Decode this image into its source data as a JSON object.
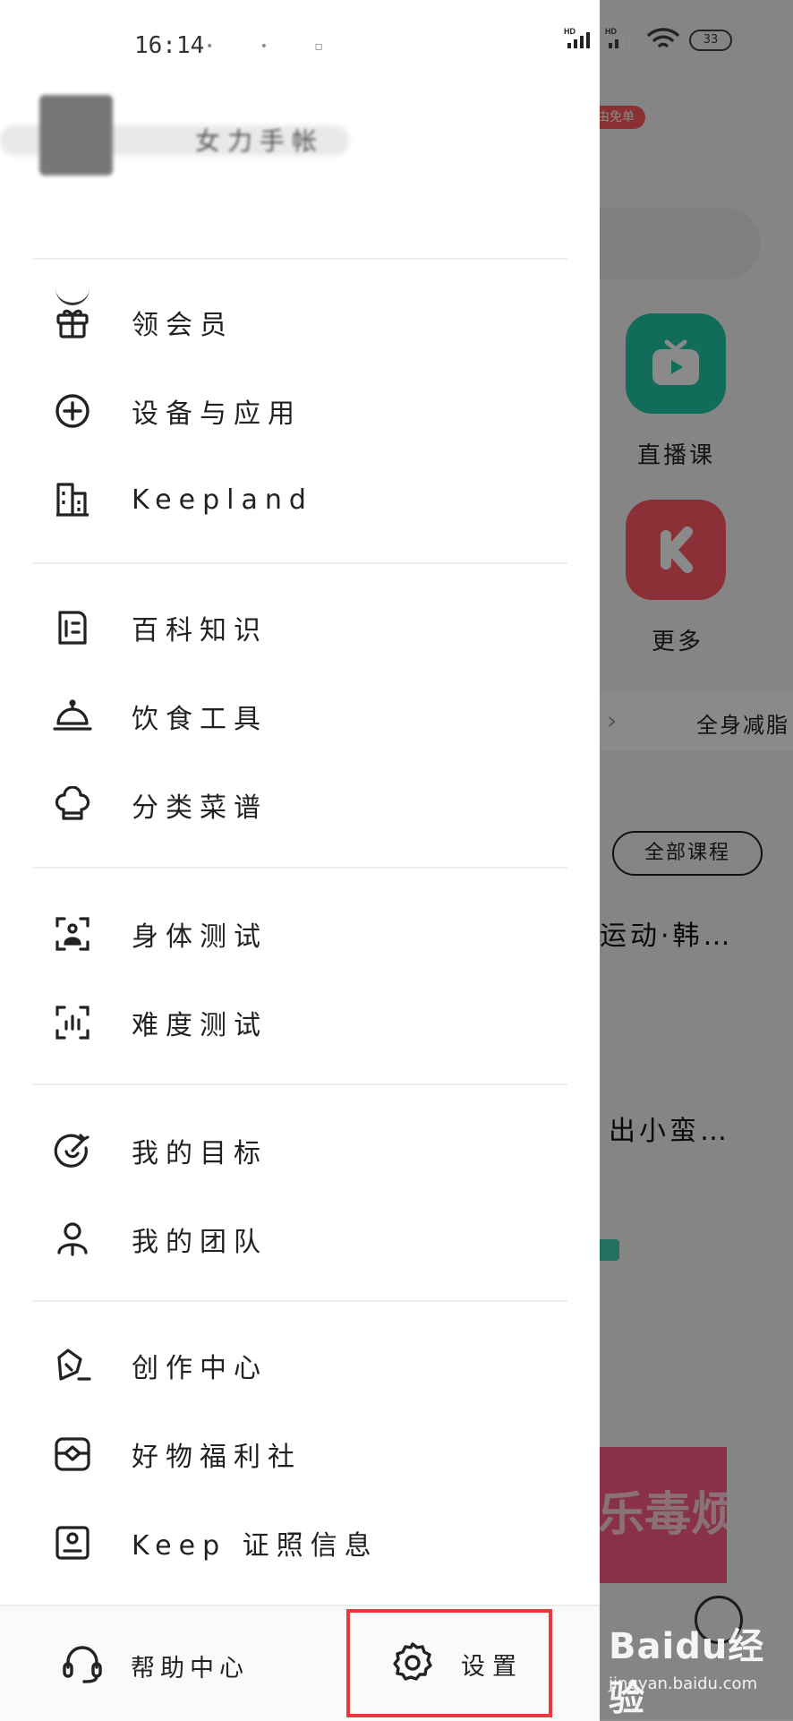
{
  "status_bar": {
    "time": "16:14",
    "hd1": "HD",
    "hd2": "HD",
    "battery": "33"
  },
  "profile": {
    "name_visible": "女力手帐"
  },
  "menu_groups": [
    [
      {
        "label": "领会员",
        "icon": "gift-icon"
      },
      {
        "label": "设备与应用",
        "icon": "plus-circle-icon"
      },
      {
        "label": "Keepland",
        "icon": "building-icon"
      }
    ],
    [
      {
        "label": "百科知识",
        "icon": "book-icon"
      },
      {
        "label": "饮食工具",
        "icon": "cloche-icon"
      },
      {
        "label": "分类菜谱",
        "icon": "chef-hat-icon"
      }
    ],
    [
      {
        "label": "身体测试",
        "icon": "body-scan-icon"
      },
      {
        "label": "难度测试",
        "icon": "level-scan-icon"
      }
    ],
    [
      {
        "label": "我的目标",
        "icon": "target-icon"
      },
      {
        "label": "我的团队",
        "icon": "team-icon"
      }
    ],
    [
      {
        "label": "创作中心",
        "icon": "pen-icon"
      },
      {
        "label": "好物福利社",
        "icon": "shop-icon"
      },
      {
        "label": "Keep 证照信息",
        "icon": "license-icon"
      }
    ]
  ],
  "bottom_bar": {
    "help_label": "帮助中心",
    "settings_label": "设置"
  },
  "background_app": {
    "badge": "由免单",
    "live_course": "直播课",
    "more": "更多",
    "chip": "全身减脂",
    "all_courses": "全部课程",
    "item1": "运动·韩…",
    "item2": "出小蛮…",
    "banner": "乐毒烦恼"
  },
  "watermark": {
    "brand": "Baidu经验",
    "url": "jingyan.baidu.com"
  },
  "colors": {
    "highlight_box": "#e8393c",
    "teal": "#21c7a6",
    "red": "#ff5a64"
  }
}
